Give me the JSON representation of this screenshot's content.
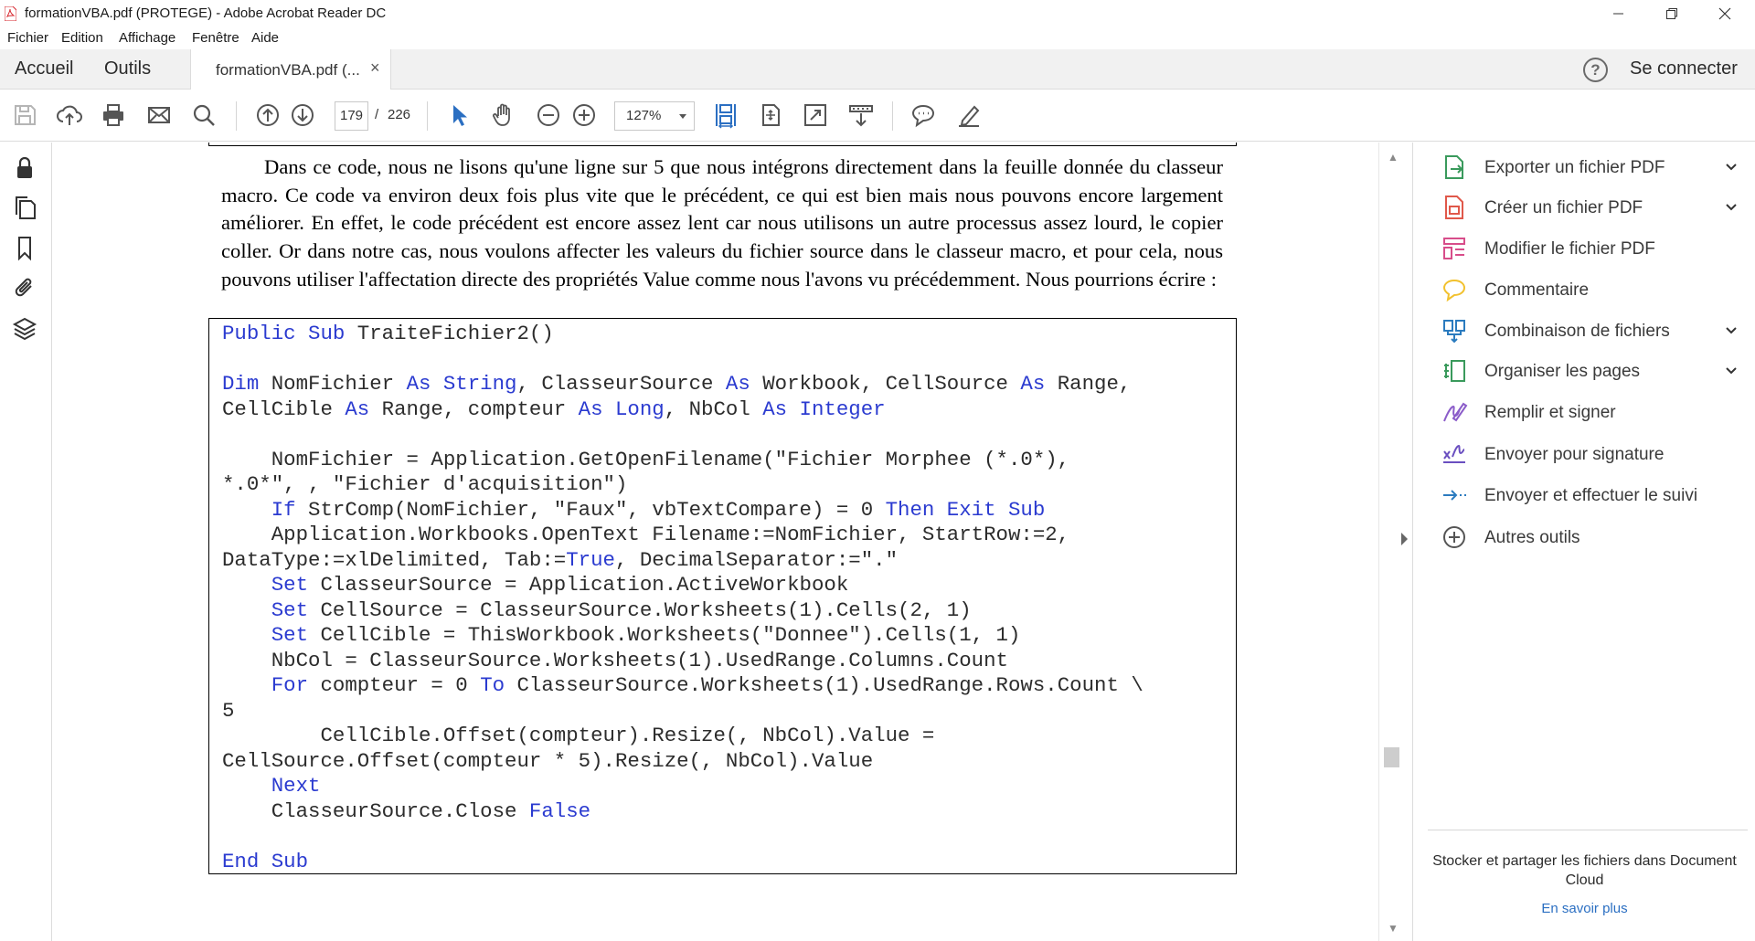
{
  "window": {
    "title": "formationVBA.pdf (PROTEGE) - Adobe Acrobat Reader DC"
  },
  "menu": [
    "Fichier",
    "Edition",
    "Affichage",
    "Fenêtre",
    "Aide"
  ],
  "tabs": {
    "home": "Accueil",
    "tools": "Outils",
    "document": "formationVBA.pdf (...",
    "close": "×"
  },
  "header": {
    "help": "?",
    "sign_in": "Se connecter"
  },
  "toolbar": {
    "page_current": "179",
    "page_separator": "/",
    "page_total": "226",
    "zoom": "127%"
  },
  "document": {
    "paragraph": "Dans ce code, nous ne lisons qu'une ligne sur 5 que nous intégrons directement dans la feuille donnée du classeur macro. Ce code va environ deux fois plus vite que le précédent, ce qui est bien mais nous pouvons encore largement améliorer. En effet, le code précédent est encore assez lent car nous utilisons un autre processus assez lourd, le copier coller. Or dans notre cas, nous voulons affecter les valeurs du fichier source dans le classeur macro, et pour cela, nous pouvons utiliser l'affectation directe des propriétés Value comme nous l'avons vu précédemment. Nous pourrions écrire :",
    "code": [
      [
        [
          "k",
          "Public Sub"
        ],
        [
          "t",
          " TraiteFichier2()"
        ]
      ],
      [],
      [
        [
          "k",
          "Dim"
        ],
        [
          "t",
          " NomFichier "
        ],
        [
          "k",
          "As String"
        ],
        [
          "t",
          ", ClasseurSource "
        ],
        [
          "k",
          "As"
        ],
        [
          "t",
          " Workbook, CellSource "
        ],
        [
          "k",
          "As"
        ],
        [
          "t",
          " Range,"
        ]
      ],
      [
        [
          "t",
          "CellCible "
        ],
        [
          "k",
          "As"
        ],
        [
          "t",
          " Range, compteur "
        ],
        [
          "k",
          "As Long"
        ],
        [
          "t",
          ", NbCol "
        ],
        [
          "k",
          "As Integer"
        ]
      ],
      [],
      [
        [
          "t",
          "    NomFichier = Application.GetOpenFilename(\"Fichier Morphee (*.0*),"
        ]
      ],
      [
        [
          "t",
          "*.0*\", , \"Fichier d'acquisition\")"
        ]
      ],
      [
        [
          "t",
          "    "
        ],
        [
          "k",
          "If"
        ],
        [
          "t",
          " StrComp(NomFichier, \"Faux\", vbTextCompare) = 0 "
        ],
        [
          "k",
          "Then Exit Sub"
        ]
      ],
      [
        [
          "t",
          "    Application.Workbooks.OpenText Filename:=NomFichier, StartRow:=2,"
        ]
      ],
      [
        [
          "t",
          "DataType:=xlDelimited, Tab:="
        ],
        [
          "k",
          "True"
        ],
        [
          "t",
          ", DecimalSeparator:=\".\""
        ]
      ],
      [
        [
          "t",
          "    "
        ],
        [
          "k",
          "Set"
        ],
        [
          "t",
          " ClasseurSource = Application.ActiveWorkbook"
        ]
      ],
      [
        [
          "t",
          "    "
        ],
        [
          "k",
          "Set"
        ],
        [
          "t",
          " CellSource = ClasseurSource.Worksheets(1).Cells(2, 1)"
        ]
      ],
      [
        [
          "t",
          "    "
        ],
        [
          "k",
          "Set"
        ],
        [
          "t",
          " CellCible = ThisWorkbook.Worksheets(\"Donnee\").Cells(1, 1)"
        ]
      ],
      [
        [
          "t",
          "    NbCol = ClasseurSource.Worksheets(1).UsedRange.Columns.Count"
        ]
      ],
      [
        [
          "t",
          "    "
        ],
        [
          "k",
          "For"
        ],
        [
          "t",
          " compteur = 0 "
        ],
        [
          "k",
          "To"
        ],
        [
          "t",
          " ClasseurSource.Worksheets(1).UsedRange.Rows.Count \\"
        ]
      ],
      [
        [
          "t",
          "5"
        ]
      ],
      [
        [
          "t",
          "        CellCible.Offset(compteur).Resize(, NbCol).Value ="
        ]
      ],
      [
        [
          "t",
          "CellSource.Offset(compteur * 5).Resize(, NbCol).Value"
        ]
      ],
      [
        [
          "t",
          "    "
        ],
        [
          "k",
          "Next"
        ]
      ],
      [
        [
          "t",
          "    ClasseurSource.Close "
        ],
        [
          "k",
          "False"
        ]
      ],
      [],
      [
        [
          "k",
          "End Sub"
        ]
      ]
    ]
  },
  "tools_panel": {
    "items": [
      {
        "label": "Exporter un fichier PDF",
        "icon": "export-pdf-icon",
        "chevron": true,
        "color": "#3a9a5c"
      },
      {
        "label": "Créer un fichier PDF",
        "icon": "create-pdf-icon",
        "chevron": true,
        "color": "#e0584a"
      },
      {
        "label": "Modifier le fichier PDF",
        "icon": "edit-pdf-icon",
        "chevron": false,
        "color": "#d84d8a"
      },
      {
        "label": "Commentaire",
        "icon": "comment-icon",
        "chevron": false,
        "color": "#f2c12e"
      },
      {
        "label": "Combinaison de fichiers",
        "icon": "combine-files-icon",
        "chevron": true,
        "color": "#2b7bbf"
      },
      {
        "label": "Organiser les pages",
        "icon": "organize-pages-icon",
        "chevron": true,
        "color": "#3a9a5c"
      },
      {
        "label": "Remplir et signer",
        "icon": "fill-sign-icon",
        "chevron": false,
        "color": "#8b5cc9"
      },
      {
        "label": "Envoyer pour signature",
        "icon": "send-signature-icon",
        "chevron": false,
        "color": "#6a4fc0"
      },
      {
        "label": "Envoyer et effectuer le suivi",
        "icon": "send-track-icon",
        "chevron": false,
        "color": "#2b7bbf"
      },
      {
        "label": "Autres outils",
        "icon": "more-tools-icon",
        "chevron": false,
        "color": "#555555"
      }
    ],
    "cloud_text": "Stocker et partager les fichiers dans Document Cloud",
    "learn_more": "En savoir plus"
  },
  "colors": {
    "keyword": "#2b3bd0",
    "link": "#2b6fc2",
    "acrobat_red": "#d7282f"
  }
}
